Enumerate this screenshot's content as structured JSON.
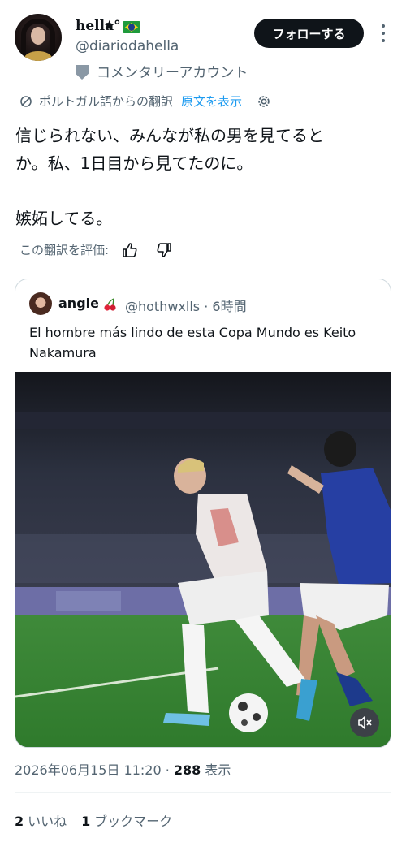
{
  "author": {
    "name": "hella°",
    "badge": "★",
    "handle": "@diariodahella",
    "label": "コメンタリーアカウント"
  },
  "actions": {
    "follow": "フォローする"
  },
  "translation": {
    "notice": "ポルトガル語からの翻訳",
    "show_original": "原文を表示",
    "rate_label": "この翻訳を評価:"
  },
  "tweet": {
    "text": "信じられない、みんなが私の男を見てると\nか。私、1日目から見てたのに。\n\n嫉妬してる。"
  },
  "quote": {
    "name": "angie",
    "handle": "@hothwxlls · 6時間",
    "text": "El hombre más lindo de esta Copa Mundo es Keito Nakamura"
  },
  "meta": {
    "timestamp": "2026年06月15日 11:20 · ",
    "views_count": "288",
    "views_label": " 表示"
  },
  "stats": {
    "likes_count": "2",
    "likes_label": "いいね",
    "bookmarks_count": "1",
    "bookmarks_label": "ブックマーク"
  },
  "colors": {
    "accent": "#1d9bf0",
    "text": "#0f1419",
    "muted": "#536471"
  }
}
